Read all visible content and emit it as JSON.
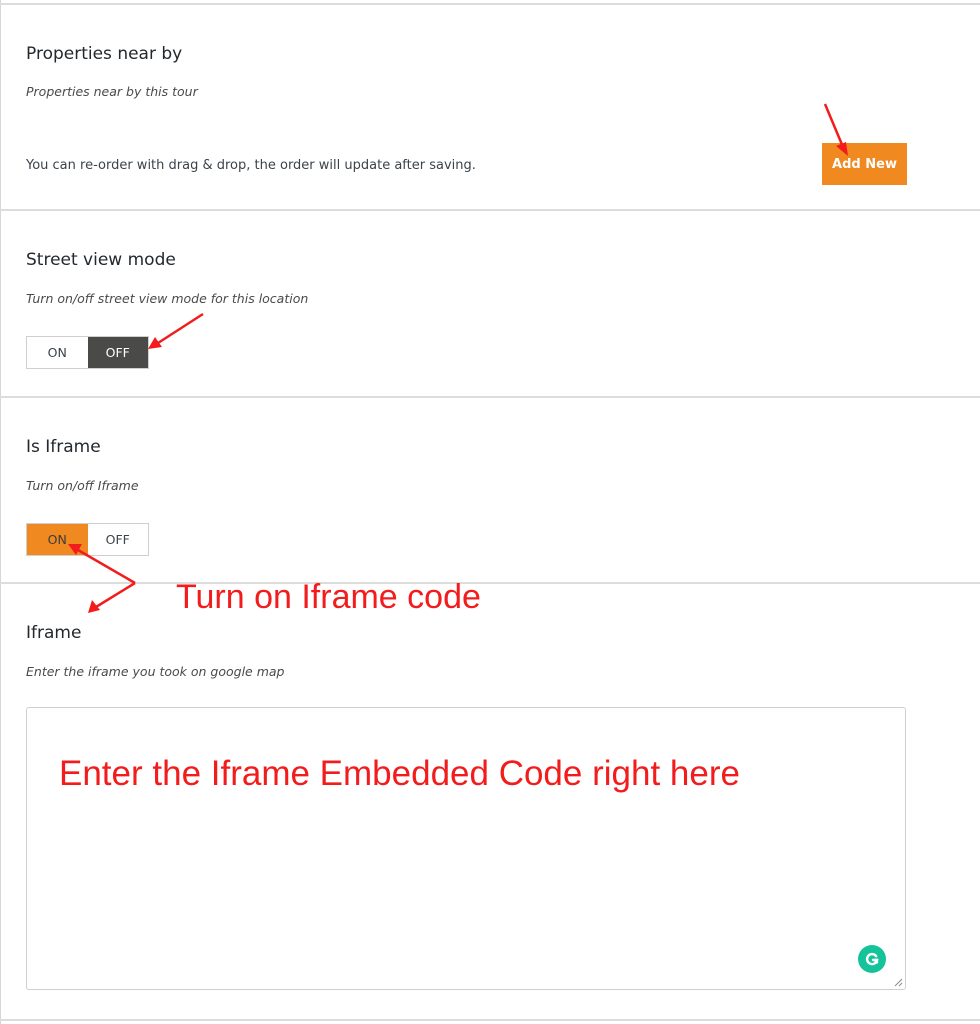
{
  "sections": {
    "properties_near_by": {
      "title": "Properties near by",
      "description": "Properties near by this tour",
      "reorder_note": "You can re-order with drag & drop, the order will update after saving.",
      "add_new_label": "Add New"
    },
    "street_view_mode": {
      "title": "Street view mode",
      "description": "Turn on/off street view mode for this location",
      "on_label": "ON",
      "off_label": "OFF",
      "selected": "OFF"
    },
    "is_iframe": {
      "title": "Is Iframe",
      "description": "Turn on/off Iframe",
      "on_label": "ON",
      "off_label": "OFF",
      "selected": "ON"
    },
    "iframe": {
      "title": "Iframe",
      "description": "Enter the iframe you took on google map",
      "value": ""
    }
  },
  "annotations": {
    "turn_on_iframe": "Turn on Iframe code",
    "enter_iframe_code": "Enter the Iframe Embedded Code right here",
    "color": "#f21c1c"
  },
  "colors": {
    "accent_orange": "#f0891f",
    "toggle_dark": "#4a4a48",
    "grammarly_green": "#15c39a"
  },
  "icons": {
    "grammarly": "grammarly-icon",
    "resize": "resize-grip-icon"
  }
}
